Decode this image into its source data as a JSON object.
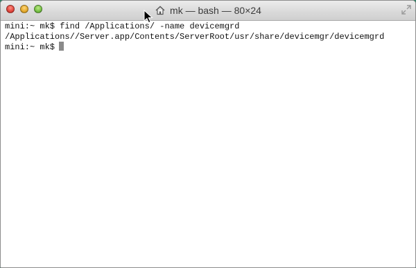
{
  "window": {
    "title": "mk — bash — 80×24"
  },
  "terminal": {
    "lines": [
      "mini:~ mk$ find /Applications/ -name devicemgrd",
      "/Applications//Server.app/Contents/ServerRoot/usr/share/devicemgr/devicemgrd"
    ],
    "prompt": "mini:~ mk$"
  },
  "icons": {
    "title_icon": "home-icon",
    "fullscreen": "fullscreen-arrows-icon",
    "pointer": "mouse-pointer-icon"
  },
  "colors": {
    "close": "#e0443b",
    "minimize": "#e3a92c",
    "zoom": "#75c044",
    "terminal_background": "#ffffff",
    "terminal_text": "#111111"
  }
}
